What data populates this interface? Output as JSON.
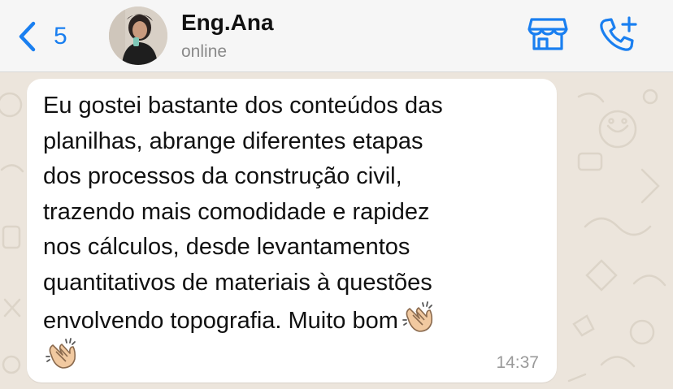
{
  "header": {
    "back_count": "5",
    "contact_name": "Eng.Ana",
    "status": "online",
    "back_icon": "chevron-left-icon",
    "store_icon": "storefront-icon",
    "call_icon": "add-call-icon"
  },
  "message": {
    "text": "Eu gostei bastante dos conteúdos das\nplanilhas, abrange diferentes etapas\ndos processos da construção civil,\ntrazendo mais comodidade e rapidez\nnos cálculos, desde levantamentos\nquantitativos de materiais à questões\nenvolvendo topografia. Muito bom",
    "emoji": "clapping-hands",
    "time": "14:37"
  },
  "colors": {
    "accent": "#1a7ff0",
    "wallpaper": "#ece5dc",
    "bubble": "#ffffff"
  }
}
